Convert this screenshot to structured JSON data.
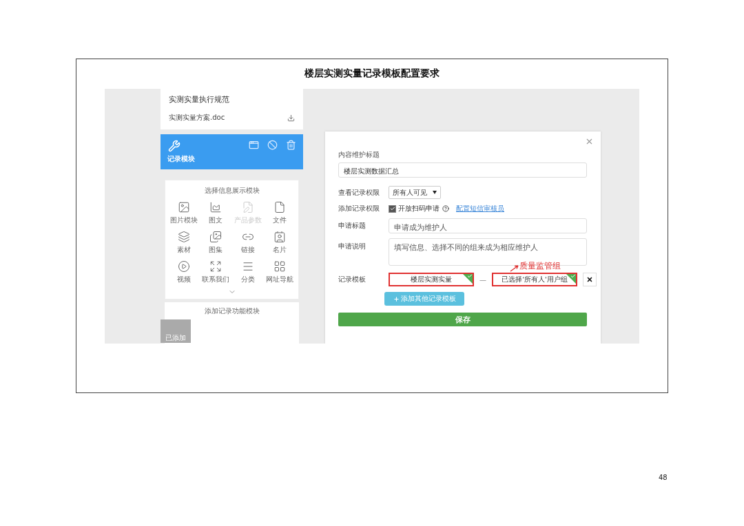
{
  "title": "楼层实测实量记录模板配置要求",
  "page_number": "48",
  "left_panel": {
    "section_title": "实测实量执行规范",
    "file": {
      "name": "实测实量方案.doc"
    },
    "record_card": {
      "label": "记录模块"
    },
    "display_modules": {
      "title": "选择信息展示模块",
      "items": [
        {
          "label": "图片模块",
          "kind": "image",
          "disabled": false
        },
        {
          "label": "图文",
          "kind": "graphic",
          "disabled": false
        },
        {
          "label": "产品参数",
          "kind": "params",
          "disabled": true
        },
        {
          "label": "文件",
          "kind": "file",
          "disabled": false
        },
        {
          "label": "素材",
          "kind": "material",
          "disabled": false
        },
        {
          "label": "图集",
          "kind": "gallery",
          "disabled": false
        },
        {
          "label": "链接",
          "kind": "link",
          "disabled": false
        },
        {
          "label": "名片",
          "kind": "card",
          "disabled": false
        },
        {
          "label": "视频",
          "kind": "video",
          "disabled": false
        },
        {
          "label": "联系我们",
          "kind": "contact",
          "disabled": false
        },
        {
          "label": "分类",
          "kind": "category",
          "disabled": false
        },
        {
          "label": "网址导航",
          "kind": "nav",
          "disabled": false
        }
      ]
    },
    "function_modules": {
      "title": "添加记录功能模块",
      "items": [
        {
          "label": "已添加"
        }
      ]
    }
  },
  "dialog": {
    "title_label": "内容维护标题",
    "title_value": "楼层实测数据汇总",
    "view_permission": {
      "label": "查看记录权限",
      "value": "所有人可见"
    },
    "add_permission": {
      "label": "添加记录权限",
      "checkbox": {
        "label": "开放扫码申请",
        "checked": true
      },
      "link": "配置短信审核员"
    },
    "apply_title": {
      "label": "申请标题",
      "value": "申请成为维护人"
    },
    "apply_desc": {
      "label": "申请说明",
      "value": "填写信息、选择不同的组来成为相应维护人"
    },
    "templates": {
      "label": "记录模板",
      "separator": "—",
      "annotation": "质量监管组",
      "items": [
        {
          "value": "楼层实测实量",
          "highlighted": true,
          "checked": true
        },
        {
          "value": "已选择'所有人'用户组",
          "highlighted": true,
          "checked": true
        }
      ]
    },
    "add_button": "添加其他记录模板",
    "save_button": "保存"
  }
}
